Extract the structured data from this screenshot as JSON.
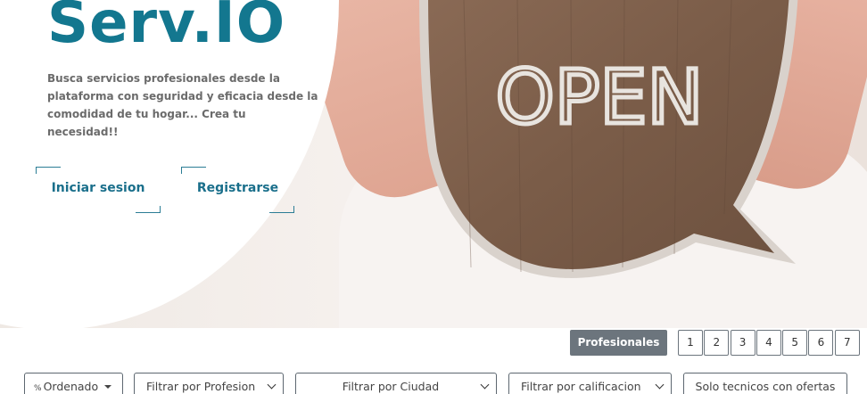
{
  "brand": {
    "logo": "Serv.IO",
    "color": "#13778f"
  },
  "hero": {
    "tagline": "Busca servicios profesionales desde la plataforma con seguridad y eficacia desde la comodidad de tu hogar... Crea tu necesidad!!",
    "sign_text": "OPEN",
    "login_label": "Iniciar sesion",
    "register_label": "Registrarse"
  },
  "results": {
    "section_label": "Profesionales",
    "pages": [
      "1",
      "2",
      "3",
      "4",
      "5",
      "6",
      "7"
    ]
  },
  "filters": {
    "sort_label": "Ordenado",
    "profession_label": "Filtrar por Profesion",
    "city_label": "Filtrar por Ciudad",
    "rating_label": "Filtrar por calificacion",
    "offers_label": "Solo tecnicos con ofertas"
  }
}
